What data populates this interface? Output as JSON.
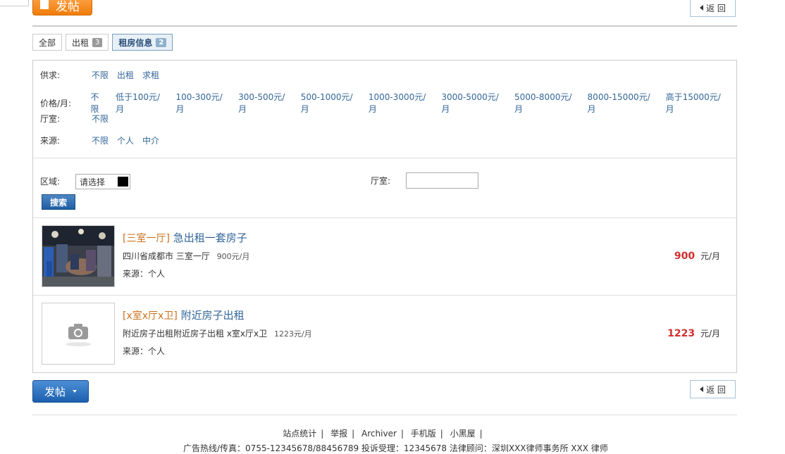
{
  "header": {
    "post_label": "发帖",
    "back_label": "返 回"
  },
  "tabs": [
    {
      "label": "全部",
      "count": ""
    },
    {
      "label": "出租",
      "count": "3"
    },
    {
      "label": "租房信息",
      "count": "2"
    }
  ],
  "filters": {
    "supply": {
      "label": "供求:",
      "options": [
        "不限",
        "出租",
        "求租"
      ]
    },
    "price": {
      "label": "价格/月:",
      "options": [
        "不限",
        "低于100元/月",
        "100-300元/月",
        "300-500元/月",
        "500-1000元/月",
        "1000-3000元/月",
        "3000-5000元/月",
        "5000-8000元/月",
        "8000-15000元/月",
        "高于15000元/月"
      ]
    },
    "hall": {
      "label": "厅室:",
      "options": [
        "不限"
      ]
    },
    "source": {
      "label": "来源:",
      "options": [
        "不限",
        "个人",
        "中介"
      ]
    }
  },
  "search": {
    "area_label": "区域:",
    "area_value": "请选择",
    "hall_label": "厅室:",
    "hall_value": "",
    "button_label": "搜索"
  },
  "listings": [
    {
      "tag": "[三室一厅]",
      "title": "急出租一套房子",
      "desc": "四川省成都市 三室一厅",
      "price_small": "900元/月",
      "source": "来源：个人",
      "price": "900",
      "unit": "元/月"
    },
    {
      "tag": "[x室x厅x卫]",
      "title": "附近房子出租",
      "desc": "附近房子出租附近房子出租 x室x厅x卫",
      "price_small": "1223元/月",
      "source": "来源：个人",
      "price": "1223",
      "unit": "元/月"
    }
  ],
  "footer": {
    "links": [
      "站点统计",
      "举报",
      "Archiver",
      "手机版",
      "小黑屋"
    ],
    "line2": "广告热线/传真：0755-12345678/88456789   投诉受理：12345678   法律顾问：深圳XXX律师事务所 XXX 律师"
  }
}
